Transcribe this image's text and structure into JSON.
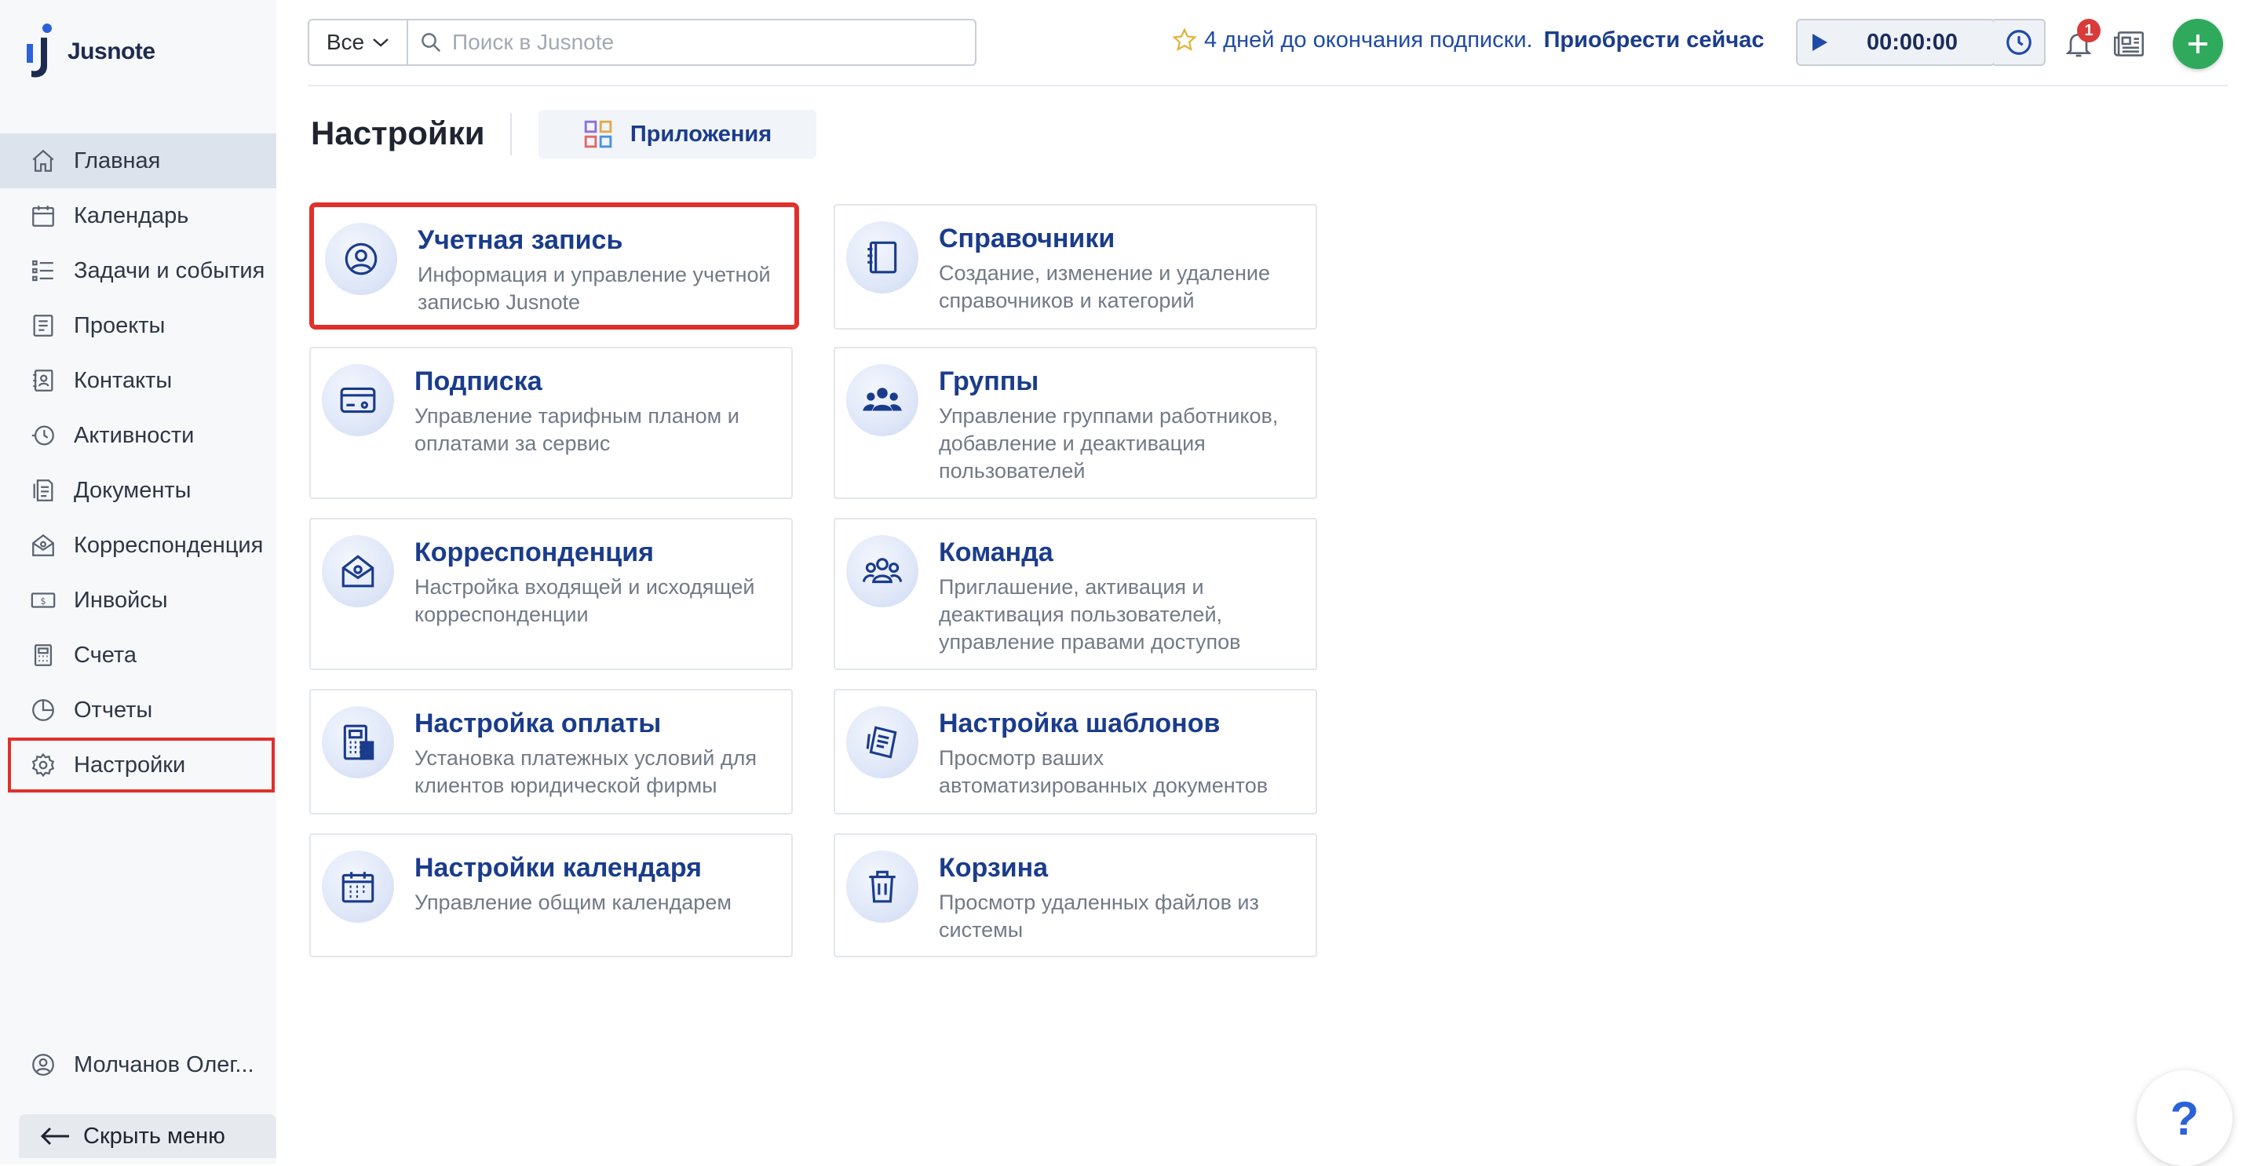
{
  "app": {
    "name": "Jusnote"
  },
  "sidebar": {
    "items": [
      {
        "label": "Главная",
        "icon": "home-icon"
      },
      {
        "label": "Календарь",
        "icon": "calendar-icon"
      },
      {
        "label": "Задачи и события",
        "icon": "tasks-icon"
      },
      {
        "label": "Проекты",
        "icon": "projects-icon"
      },
      {
        "label": "Контакты",
        "icon": "contacts-icon"
      },
      {
        "label": "Активности",
        "icon": "activity-icon"
      },
      {
        "label": "Документы",
        "icon": "documents-icon"
      },
      {
        "label": "Корреспонденция",
        "icon": "correspondence-icon"
      },
      {
        "label": "Инвойсы",
        "icon": "invoices-icon"
      },
      {
        "label": "Счета",
        "icon": "accounts-icon"
      },
      {
        "label": "Отчеты",
        "icon": "reports-icon"
      },
      {
        "label": "Настройки",
        "icon": "settings-icon"
      }
    ],
    "user_name": "Молчанов Олег...",
    "hide_menu_label": "Скрыть меню"
  },
  "topbar": {
    "scope_label": "Все",
    "search_placeholder": "Поиск в Jusnote",
    "search_value": "",
    "promo_text": "4 дней до окончания подписки.",
    "promo_link": "Приобрести сейчас",
    "timer_value": "00:00:00",
    "notification_count": "1"
  },
  "page": {
    "title": "Настройки",
    "apps_tab_label": "Приложения"
  },
  "cards": [
    {
      "title": "Учетная запись",
      "desc": "Информация и управление учетной записью Jusnote",
      "icon": "user-circle-icon"
    },
    {
      "title": "Справочники",
      "desc": "Создание, изменение и удаление справочников и категорий",
      "icon": "directory-book-icon"
    },
    {
      "title": "Подписка",
      "desc": "Управление тарифным планом и оплатами за сервис",
      "icon": "credit-card-icon"
    },
    {
      "title": "Группы",
      "desc": "Управление группами работников, добавление и деактивация пользователей",
      "icon": "groups-icon"
    },
    {
      "title": "Корреспонденция",
      "desc": "Настройка входящей и исходящей корреспонденции",
      "icon": "envelope-icon"
    },
    {
      "title": "Команда",
      "desc": "Приглашение, активация и деактивация пользователей, управление правами доступов",
      "icon": "team-icon"
    },
    {
      "title": "Настройка оплаты",
      "desc": "Установка платежных условий для клиентов юридической фирмы",
      "icon": "payment-terminal-icon"
    },
    {
      "title": "Настройка шаблонов",
      "desc": "Просмотр ваших автоматизированных документов",
      "icon": "templates-icon"
    },
    {
      "title": "Настройки календаря",
      "desc": "Управление общим календарем",
      "icon": "calendar-settings-icon"
    },
    {
      "title": "Корзина",
      "desc": "Просмотр удаленных файлов из системы",
      "icon": "trash-icon"
    }
  ],
  "help": {
    "label": "?"
  },
  "colors": {
    "accent": "#1a3c8c",
    "highlight": "#e0302b",
    "add": "#2faa5d",
    "badge": "#d93a3a"
  }
}
